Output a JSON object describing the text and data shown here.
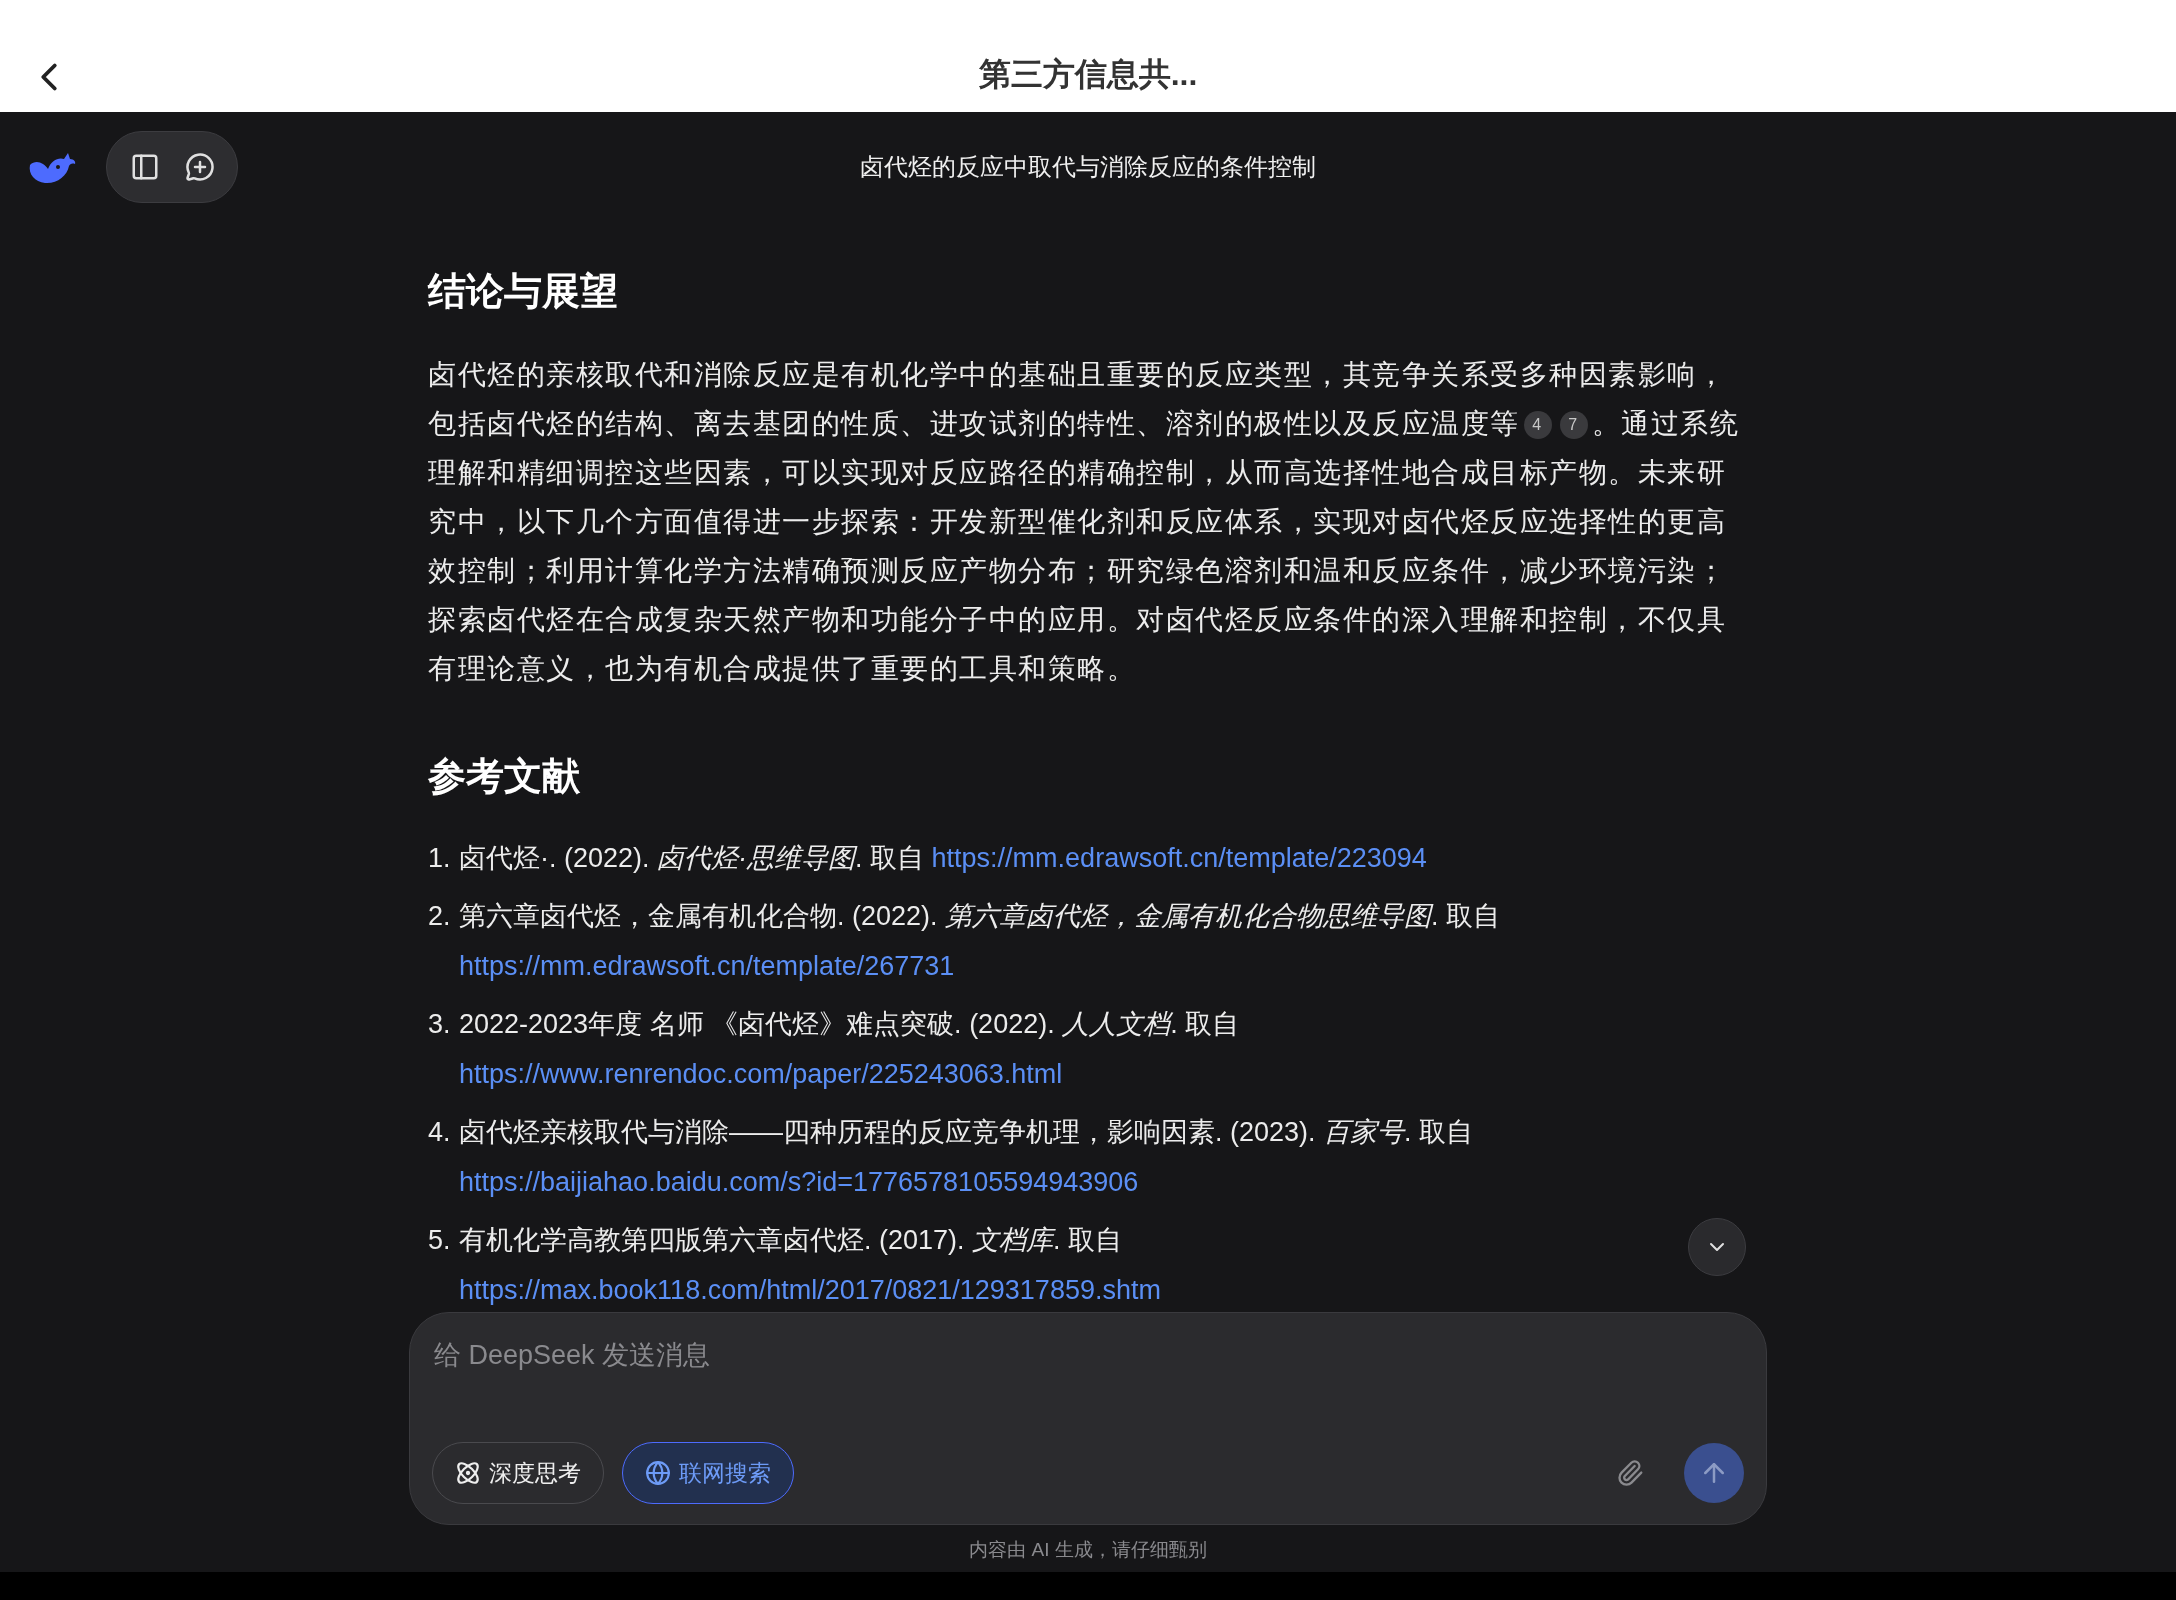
{
  "top_bar": {
    "title": "第三方信息共..."
  },
  "chat_header": {
    "title": "卤代烃的反应中取代与消除反应的条件控制"
  },
  "sections": [
    {
      "heading": "结论与展望",
      "paragraph": {
        "before": "卤代烃的亲核取代和消除反应是有机化学中的基础且重要的反应类型，其竞争关系受多种因素影响，包括卤代烃的结构、离去基团的性质、进攻试剂的特性、溶剂的极性以及反应温度等",
        "citations": [
          "4",
          "7"
        ],
        "after": "。通过系统理解和精细调控这些因素，可以实现对反应路径的精确控制，从而高选择性地合成目标产物。未来研究中，以下几个方面值得进一步探索：开发新型催化剂和反应体系，实现对卤代烃反应选择性的更高效控制；利用计算化学方法精确预测反应产物分布；研究绿色溶剂和温和反应条件，减少环境污染；探索卤代烃在合成复杂天然产物和功能分子中的应用。对卤代烃反应条件的深入理解和控制，不仅具有理论意义，也为有机合成提供了重要的工具和策略。"
      }
    },
    {
      "heading": "参考文献",
      "references": [
        {
          "number": "1.",
          "text": "卤代烃·. (2022). *卤代烃·思维导图*. 取自",
          "url": "https://mm.edrawsoft.cn/template/223094"
        },
        {
          "number": "2.",
          "text": "第六章卤代烃，金属有机化合物. (2022). *第六章卤代烃，金属有机化合物思维导图*. 取自",
          "url": "https://mm.edrawsoft.cn/template/267731"
        },
        {
          "number": "3.",
          "text": "2022-2023年度 名师 《卤代烃》难点突破. (2022). *人人文档*. 取自",
          "url": "https://www.renrendoc.com/paper/225243063.html"
        },
        {
          "number": "4.",
          "text": "卤代烃亲核取代与消除——四种历程的反应竞争机理，影响因素. (2023). *百家号*. 取自",
          "url": "https://baijiahao.baidu.com/s?id=1776578105594943906"
        },
        {
          "number": "5.",
          "text": "有机化学高教第四版第六章卤代烃. (2017). *文档库*. 取自",
          "url": "https://max.book118.com/html/2017/0821/129317859.shtm"
        }
      ]
    }
  ],
  "composer": {
    "placeholder": "给 DeepSeek 发送消息",
    "toggles": [
      {
        "label": "深度思考",
        "kind": "think",
        "selected": false
      },
      {
        "label": "联网搜索",
        "kind": "web",
        "selected": true
      }
    ],
    "send_disabled": true
  },
  "disclaimer": "内容由 AI 生成，请仔细甄别"
}
